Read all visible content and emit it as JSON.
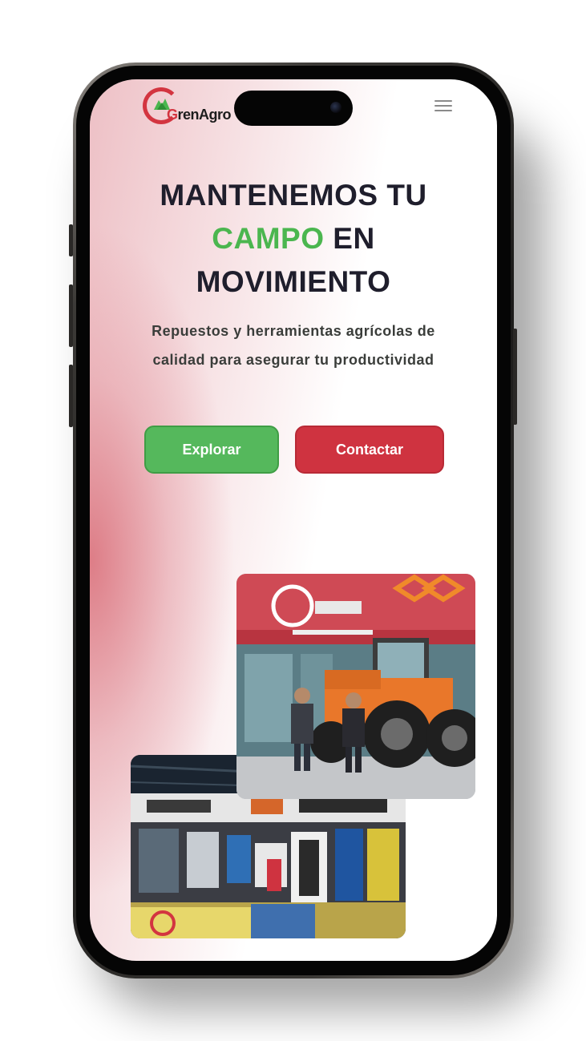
{
  "brand": {
    "logo_lead": "G",
    "logo_rest": "renAgro",
    "logo_alt": "GrenAgro",
    "primary_color": "#cf3340",
    "accent_color": "#4bb64f"
  },
  "header": {
    "menu_icon": "hamburger-menu-icon"
  },
  "hero": {
    "headline_part1": "MANTENEMOS TU",
    "headline_accent": "CAMPO",
    "headline_part2": "EN",
    "headline_part3": "MOVIMIENTO",
    "subtitle": "Repuestos y herramientas agrícolas de calidad para asegurar tu productividad"
  },
  "actions": {
    "explore_label": "Explorar",
    "contact_label": "Contactar"
  },
  "gallery": {
    "images": [
      "storefront-with-tractor-photo",
      "store-interior-photo"
    ]
  }
}
